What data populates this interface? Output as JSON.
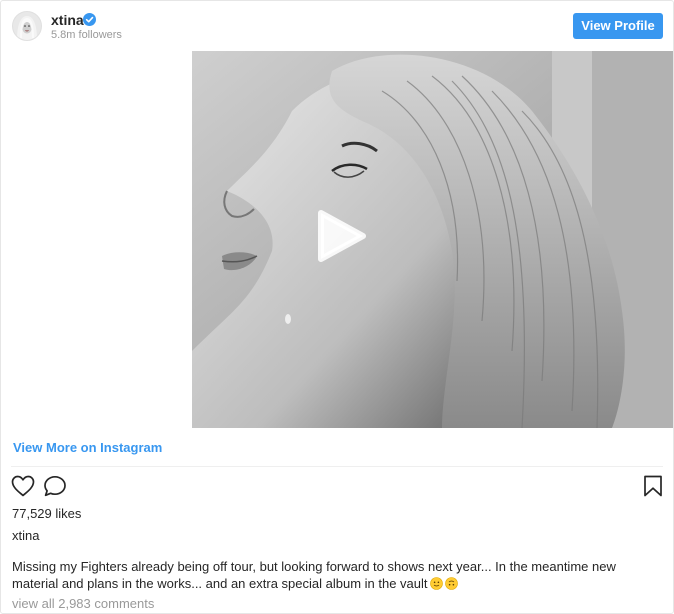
{
  "header": {
    "username": "xtina",
    "followers": "5.8m followers",
    "view_profile_label": "View Profile"
  },
  "media": {
    "type": "video"
  },
  "view_more_label": "View More on Instagram",
  "engagement": {
    "likes": "77,529 likes"
  },
  "post": {
    "caption_user": "xtina",
    "caption_text": "Missing my Fighters already being off tour, but looking forward to shows next year... In the meantime new material and plans in the works... and an extra special album in the vault",
    "caption_emojis": [
      "slightly-smiling-face-emoji",
      "upside-down-face-emoji"
    ],
    "comments_link": "view all 2,983 comments"
  },
  "icons": {
    "like": "heart-icon",
    "comment": "comment-bubble-icon",
    "save": "bookmark-icon",
    "verified": "verified-badge-icon",
    "play": "play-icon"
  },
  "colors": {
    "accent": "#3897f0",
    "text": "#262626",
    "muted": "#999999",
    "border": "#e6e6e6"
  }
}
